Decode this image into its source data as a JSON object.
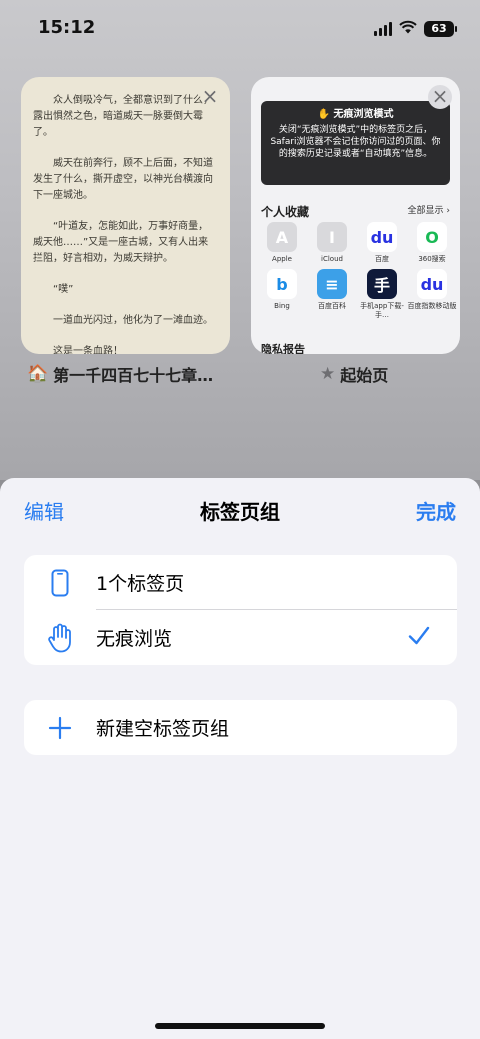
{
  "status": {
    "time": "15:12",
    "battery": "63"
  },
  "tabs": [
    {
      "title": "第一千四百七十七章…",
      "content": [
        "众人倒吸冷气，全都意识到了什么，露出惧然之色，暗道威天一脉要倒大霉了。",
        "威天在前奔行，顾不上后面，不知道发生了什么，撕开虚空，以神光台横渡向下一座城池。",
        "“叶道友，怎能如此，万事好商量，威天他……”又是一座古城，又有人出来拦阻，好言相劝，为威天辩护。",
        "“噗”",
        "一道血光闪过，他化为了一滩血迹。",
        "这是一条血路！"
      ]
    },
    {
      "title": "起始页",
      "private_title": "无痕浏览模式",
      "private_desc": "关闭“无痕浏览模式”中的标签页之后，Safari浏览器不会记住你访问过的页面、你的搜索历史记录或者“自动填充”信息。",
      "favorites_title": "个人收藏",
      "show_all": "全部显示 ›",
      "favorites": [
        {
          "label": "Apple",
          "glyph": "A",
          "bg": "#d9d9dc",
          "fg": "#ffffff"
        },
        {
          "label": "iCloud",
          "glyph": "I",
          "bg": "#d9d9dc",
          "fg": "#ffffff"
        },
        {
          "label": "百度",
          "glyph": "du",
          "bg": "#ffffff",
          "fg": "#2932e1"
        },
        {
          "label": "360搜索",
          "glyph": "O",
          "bg": "#ffffff",
          "fg": "#19b955"
        },
        {
          "label": "Bing",
          "glyph": "b",
          "bg": "#ffffff",
          "fg": "#1b8ce6"
        },
        {
          "label": "百度百科",
          "glyph": "≡",
          "bg": "#3ca0e8",
          "fg": "#ffffff"
        },
        {
          "label": "手机app下载-手…",
          "glyph": "手",
          "bg": "#0f1a3a",
          "fg": "#ffffff"
        },
        {
          "label": "百度指数移动版",
          "glyph": "du",
          "bg": "#ffffff",
          "fg": "#2932e1"
        }
      ],
      "privacy_report": "隐私报告"
    }
  ],
  "sheet": {
    "edit": "编辑",
    "title": "标签页组",
    "done": "完成",
    "groups": [
      {
        "label": "1个标签页",
        "icon": "phone-icon"
      },
      {
        "label": "无痕浏览",
        "icon": "hand-raised-icon",
        "selected": true
      }
    ],
    "new_group": "新建空标签页组"
  },
  "colors": {
    "accent": "#2a7df0",
    "sheet_bg": "#f2f2f7"
  }
}
